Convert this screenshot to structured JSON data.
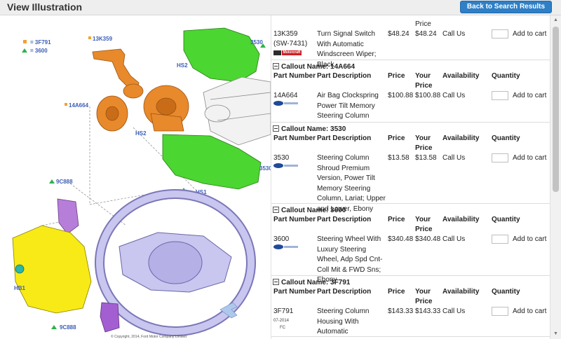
{
  "header": {
    "title": "View Illustration",
    "back_button": "Back to Search Results"
  },
  "illustration": {
    "legend": [
      {
        "symbol": "square",
        "color": "#f0a32f",
        "label": "= 3F791"
      },
      {
        "symbol": "triangle",
        "color": "#2bb34a",
        "label": "= 3600"
      }
    ],
    "callouts": [
      "13K359",
      "3530",
      "HS2",
      "14A664",
      "HS2",
      "3530",
      "HS1",
      "9C888",
      "HB1",
      "9C888"
    ],
    "copyright": "© Copyright, 2014, Ford Motor Company Limited"
  },
  "columns": {
    "part_number": "Part Number",
    "description": "Part Description",
    "price": "Price",
    "your_price": "Your Price",
    "availability": "Availability",
    "quantity": "Quantity"
  },
  "top_row": {
    "your_price_tail": "Price",
    "part_number": "13K359",
    "part_alt": "(SW-7431)",
    "description": "Turn Signal Switch With Automatic Windscreen Wiper; Black",
    "price": "$48.24",
    "your_price": "$48.24",
    "availability": "Call Us",
    "add_to_cart": "Add to cart",
    "brand": "Motorcraft"
  },
  "sections": [
    {
      "callout": "Callout Name: 14A664",
      "part_number": "14A664",
      "description": "Air Bag Clockspring Power Tilt Memory Steering Column",
      "price": "$100.88",
      "your_price": "$100.88",
      "availability": "Call Us",
      "add_to_cart": "Add to cart"
    },
    {
      "callout": "Callout Name: 3530",
      "part_number": "3530",
      "description": "Steering Column Shroud Premium Version, Power Tilt Memory Steering Column, Lariat; Upper and Lower, Ebony",
      "price": "$13.58",
      "your_price": "$13.58",
      "availability": "Call Us",
      "add_to_cart": "Add to cart"
    },
    {
      "callout": "Callout Name: 3600",
      "part_number": "3600",
      "description": "Steering Wheel With Luxury Steering Wheel, Adp Spd Cnt-Coll Mit & FWD Sns; Ebony",
      "price": "$340.48",
      "your_price": "$340.48",
      "availability": "Call Us",
      "add_to_cart": "Add to cart"
    },
    {
      "callout": "Callout Name: 3F791",
      "part_number": "3F791",
      "description": "Steering Column Housing With Automatic",
      "price": "$143.33",
      "your_price": "$143.33",
      "availability": "Call Us",
      "add_to_cart": "Add to cart",
      "stamp": [
        "07-2014",
        "FC"
      ]
    }
  ]
}
